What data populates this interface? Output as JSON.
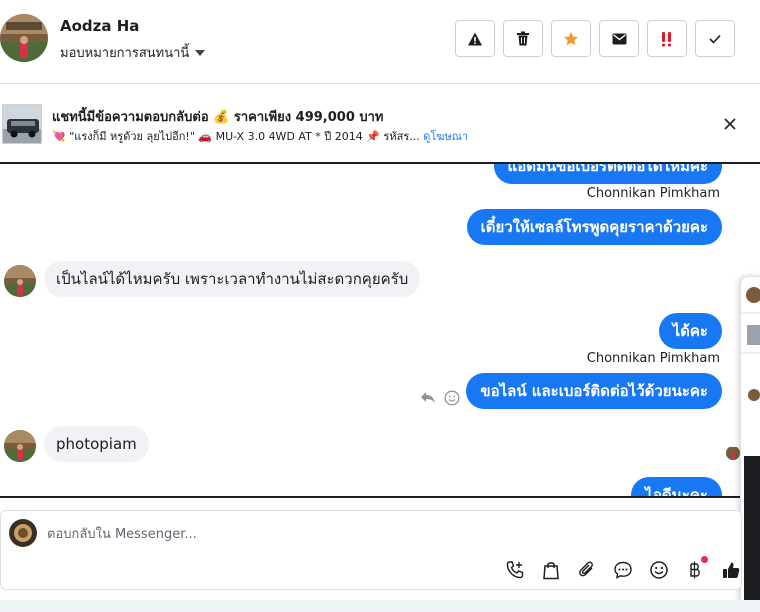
{
  "header": {
    "name": "Aodza Ha",
    "assign_label": "มอบหมายการสนทนานี้",
    "actions": [
      {
        "id": "spam",
        "icon": "warning-icon"
      },
      {
        "id": "delete",
        "icon": "trash-icon"
      },
      {
        "id": "follow-up",
        "icon": "star-icon",
        "color": "#f59b2b"
      },
      {
        "id": "mark-unread",
        "icon": "envelope-icon"
      },
      {
        "id": "urgent",
        "icon": "double-exclamation-icon",
        "color": "#e4162a"
      },
      {
        "id": "done",
        "icon": "check-icon"
      }
    ]
  },
  "ad": {
    "title": "แชทนี้มีข้อความตอบกลับต่อ 💰 ราคาเพียง 499,000 บาท",
    "subtitle": "💘 \"แรงก็มี หรูด้วย ลุยไปอีก!\" 🚗 MU-X 3.0 4WD AT * ปี 2014 📌 รหัสร...",
    "link_label": "ดูโฆษณา"
  },
  "messages": [
    {
      "dir": "out",
      "text": "แอดมินขอเบอร์ติดต่อได้ไหมคะ"
    },
    {
      "dir": "sender",
      "text": "Chonnikan Pimkham"
    },
    {
      "dir": "out",
      "text": "เดี๋ยวให้เซลล์โทรพูดคุยราคาด้วยคะ"
    },
    {
      "dir": "in",
      "text": "เป็นไลน์ได้ไหมครับ เพราะเวลาทำงานไม่สะดวกคุยครับ"
    },
    {
      "dir": "out",
      "text": "ได้คะ"
    },
    {
      "dir": "sender",
      "text": "Chonnikan Pimkham"
    },
    {
      "dir": "out",
      "text": "ขอไลน์ และเบอร์ติดต่อไว้ด้วยนะคะ"
    },
    {
      "dir": "in",
      "text": "photopiam"
    },
    {
      "dir": "out",
      "text": "ไอดีนะคะ"
    }
  ],
  "composer": {
    "placeholder": "ตอบกลับใน Messenger...",
    "tools": [
      "phone-plus-icon",
      "shopping-bag-icon",
      "paperclip-icon",
      "chat-bubble-icon",
      "smiley-icon",
      "baht-icon",
      "thumbs-up-icon"
    ]
  },
  "colors": {
    "accent": "#1877f2",
    "incoming_bubble": "#f0f2f5",
    "notification": "#f02849"
  }
}
